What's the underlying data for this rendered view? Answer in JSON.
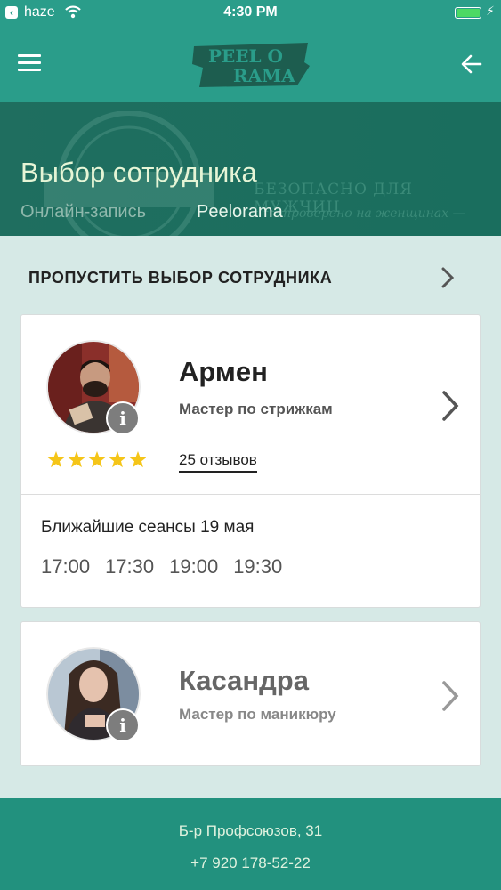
{
  "status_bar": {
    "carrier": "haze",
    "time": "4:30 PM",
    "battery_level": 1.0
  },
  "header": {
    "logo_text_line1": "PEEL O",
    "logo_text_line2": "RAMA",
    "menu_icon": "hamburger-menu-icon",
    "back_icon": "arrow-left-icon"
  },
  "hero": {
    "title": "Выбор сотрудника",
    "breadcrumb": [
      "Онлайн-запись",
      "Peelorama"
    ],
    "slogan_line1": "БЕЗОПАСНО ДЛЯ МУЖЧИН",
    "slogan_line2": "проверено на женщинах —"
  },
  "skip": {
    "label": "ПРОПУСТИТЬ ВЫБОР СОТРУДНИКА"
  },
  "employees": [
    {
      "name": "Армен",
      "role": "Мастер по стрижкам",
      "rating": 5,
      "reviews": "25 отзывов",
      "sessions_title": "Ближайшие сеансы 19 мая",
      "slots": [
        "17:00",
        "17:30",
        "19:00",
        "19:30"
      ]
    },
    {
      "name": "Касандра",
      "role": "Мастер по маникюру"
    }
  ],
  "footer": {
    "address": "Б-р Профсоюзов, 31",
    "phone": "+7 920 178-52-22"
  },
  "colors": {
    "primary": "#2a9d8a",
    "hero": "#1f6e5f",
    "footer": "#22917e",
    "star": "#f5c518",
    "battery": "#4cd964"
  }
}
